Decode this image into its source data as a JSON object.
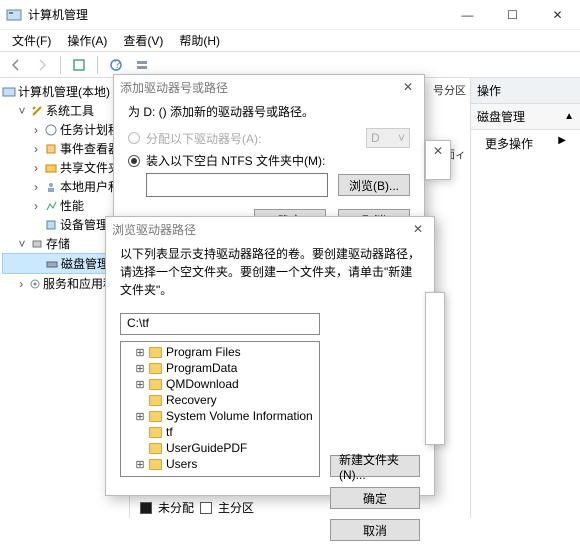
{
  "window": {
    "title": "计算机管理",
    "buttons": {
      "min": "—",
      "max": "☐",
      "close": "✕"
    }
  },
  "menu": {
    "file": "文件(F)",
    "action": "操作(A)",
    "view": "查看(V)",
    "help": "帮助(H)"
  },
  "tree": {
    "root": "计算机管理(本地)",
    "sys_tools": "系统工具",
    "task_scheduler": "任务计划程",
    "event_viewer": "事件查看器",
    "shared_folders": "共享文件夹",
    "local_users": "本地用户和",
    "performance": "性能",
    "device_manager": "设备管理器",
    "storage": "存储",
    "disk_mgmt": "磁盘管理",
    "services": "服务和应用程序"
  },
  "actions_panel": {
    "header": "操作",
    "section": "磁盘管理",
    "more": "更多操作"
  },
  "dialog1": {
    "title": "添加驱动器号或路径",
    "desc": "为 D: () 添加新的驱动器号或路径。",
    "assign_label": "分配以下驱动器号(A):",
    "drive_letter": "D",
    "mount_label": "装入以下空白 NTFS 文件夹中(M):",
    "path_value": "",
    "browse": "浏览(B)...",
    "ok": "确定",
    "cancel": "取消"
  },
  "dialog2": {
    "title": "浏览驱动器路径",
    "desc": "以下列表显示支持驱动器路径的卷。要创建驱动器路径，请选择一个空文件夹。要创建一个文件夹，请单击\"新建文件夹\"。",
    "path_value": "C:\\tf",
    "folders": [
      "Program Files",
      "ProgramData",
      "QMDownload",
      "Recovery",
      "System Volume Information",
      "tf",
      "UserGuidePDF",
      "Users"
    ],
    "new_folder": "新建文件夹(N)...",
    "ok": "确定",
    "cancel": "取消"
  },
  "fragments": {
    "col1": "号分区",
    "col2": "面ィ"
  },
  "legend": {
    "unalloc": "未分配",
    "primary": "主分区"
  }
}
